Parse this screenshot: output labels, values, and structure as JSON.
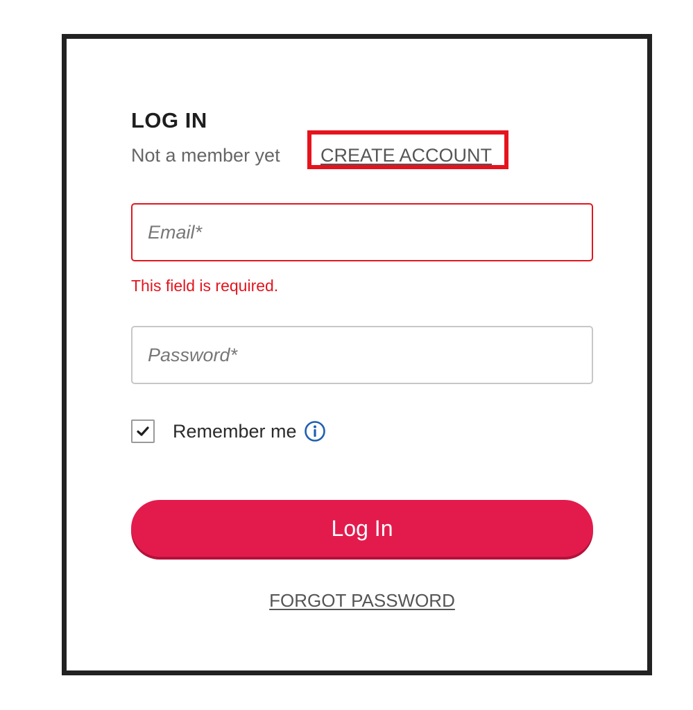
{
  "login": {
    "title": "LOG IN",
    "not_member_text": "Not a member yet",
    "create_account_label": "CREATE ACCOUNT",
    "email_placeholder": "Email*",
    "email_error": "This field is required.",
    "password_placeholder": "Password*",
    "remember_me_label": "Remember me",
    "remember_me_checked": true,
    "login_button_label": "Log In",
    "forgot_password_label": "FORGOT PASSWORD"
  },
  "icons": {
    "checkbox": "check-icon",
    "info": "info-icon"
  },
  "colors": {
    "accent": "#e31b4d",
    "error": "#e2151e",
    "highlight_box": "#e6131d",
    "info_blue": "#1f5fb0",
    "frame": "#222222"
  }
}
